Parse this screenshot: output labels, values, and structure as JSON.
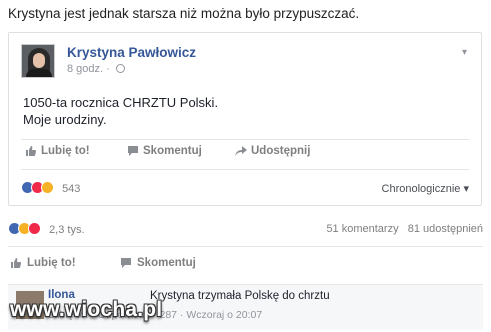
{
  "caption": "Krystyna jest jednak starsza niż można było przypuszczać.",
  "post": {
    "author": "Krystyna Pawłowicz",
    "time": "8 godz. ·",
    "text_line1": "1050-ta rocznica CHRZTU Polski.",
    "text_line2": "Moje urodziny.",
    "actions": {
      "like": "Lubię to!",
      "comment": "Skomentuj",
      "share": "Udostępnij"
    },
    "reaction_count": "543",
    "sort_label": "Chronologicznie ▾"
  },
  "outer": {
    "reaction_count": "2,3 tys.",
    "comments": "51 komentarzy",
    "shares": "81 udostępnień",
    "actions": {
      "like": "Lubię to!",
      "comment": "Skomentuj"
    }
  },
  "comment": {
    "author": "Ilona",
    "text": "Krystyna trzymała Polskę do chrztu",
    "meta": "Lubię to! · Odpowiedz · 287 · Wczoraj o 20:07"
  },
  "watermark": "www.wiocha.pl",
  "colors": {
    "link": "#365899",
    "like": "#4267b2",
    "love": "#f0284a",
    "haha": "#f7b125"
  },
  "icons": [
    "thumbs-up-icon",
    "comment-icon",
    "share-icon",
    "globe-icon",
    "chevron-down-icon"
  ]
}
